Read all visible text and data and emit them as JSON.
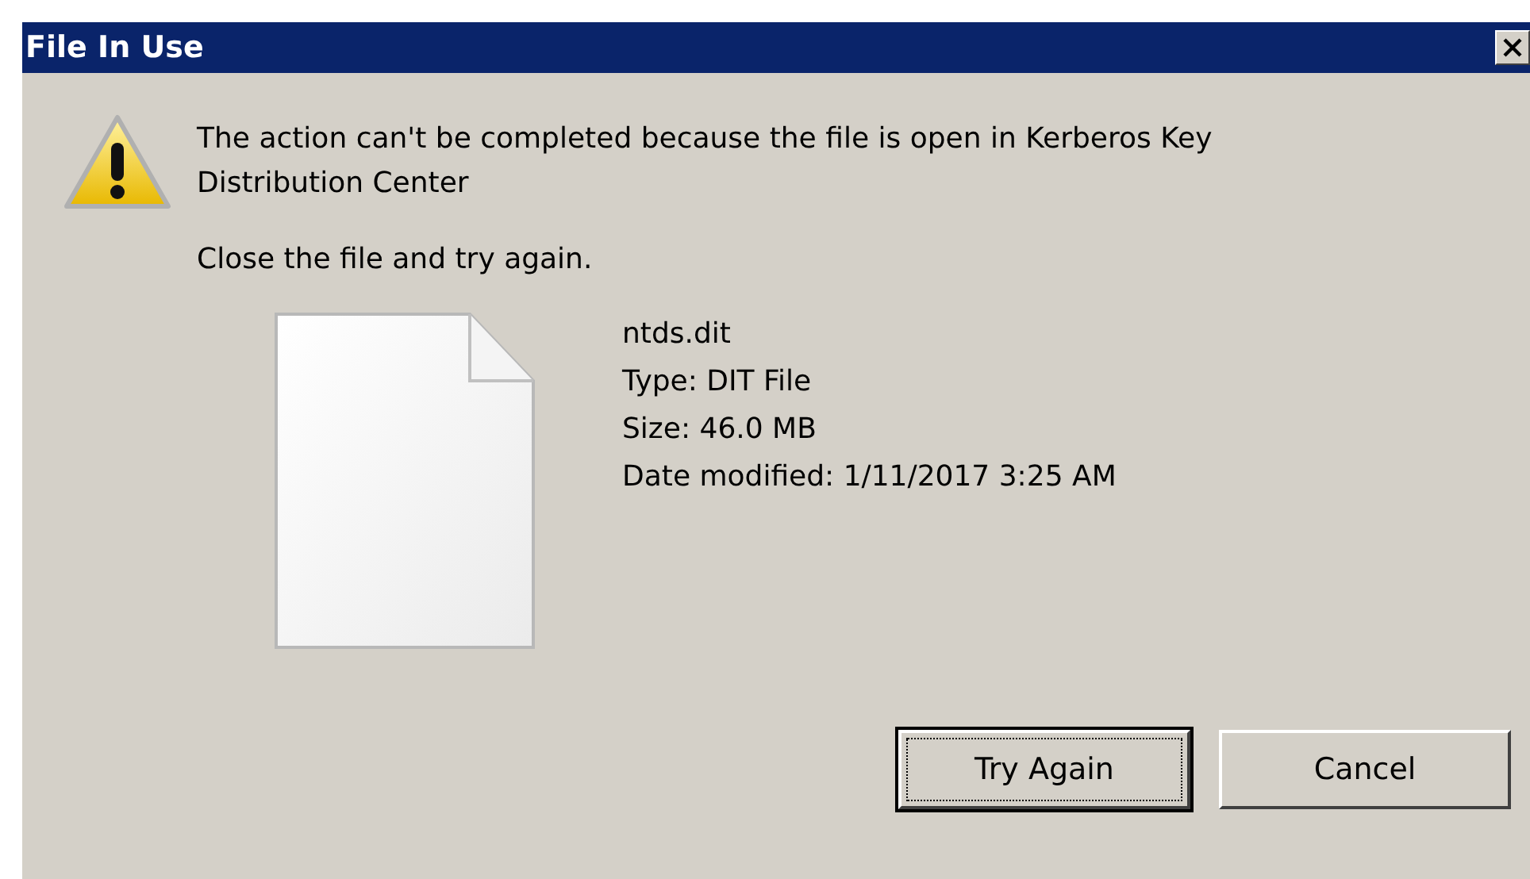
{
  "window": {
    "title": "File In Use"
  },
  "message": "The action can't be completed because the file is open in Kerberos Key Distribution Center",
  "instruction": "Close the file and try again.",
  "file": {
    "name": "ntds.dit",
    "type": "Type: DIT File",
    "size": "Size: 46.0 MB",
    "modified": "Date modified: 1/11/2017 3:25 AM"
  },
  "buttons": [
    {
      "label": "Try Again",
      "focused": true
    },
    {
      "label": "Cancel",
      "focused": false
    }
  ]
}
